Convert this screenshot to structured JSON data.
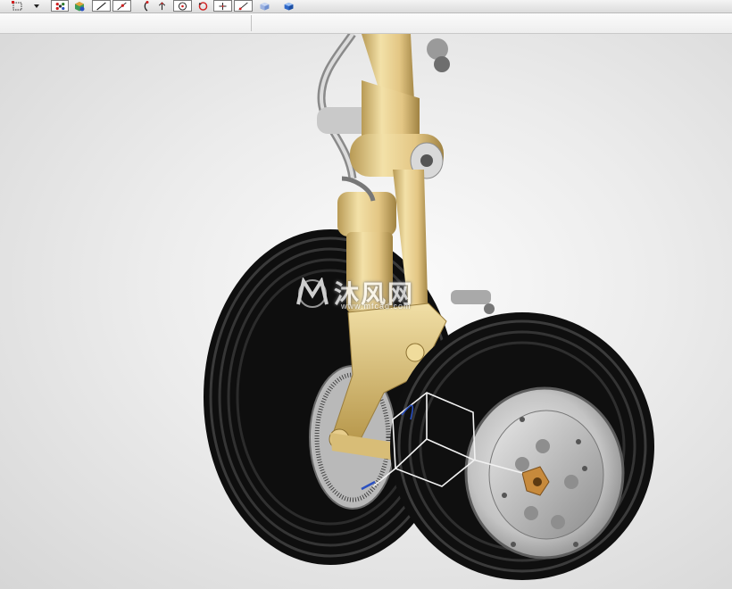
{
  "toolbar": {
    "icons": [
      "select-box-icon",
      "dropdown-arrow-icon",
      "filter-grid-icon",
      "cube-snap-icon",
      "line-icon",
      "point-on-line-icon",
      "arc-icon",
      "axis-icon",
      "circle-center-icon",
      "circle-refresh-icon",
      "cross-icon",
      "line-point-icon",
      "view-cube-icon",
      "solid-cube-icon"
    ]
  },
  "watermark": {
    "text": "沐风网",
    "sub": "www.mfcad.com"
  },
  "colors": {
    "strut": "#e7cd8c",
    "strut_shadow": "#b89a55",
    "tire": "#111111",
    "rim": "#c8c8c8",
    "triad": "#f2f2f2"
  }
}
